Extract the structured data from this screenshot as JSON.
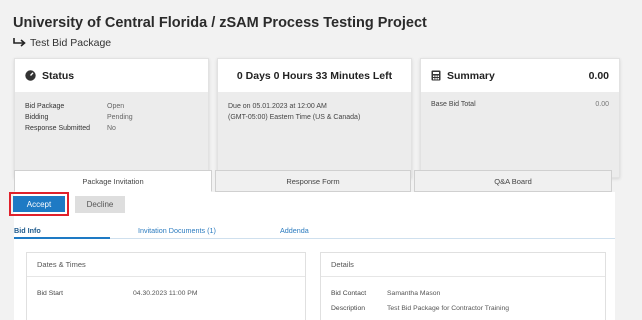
{
  "header": {
    "title": "University of Central Florida / zSAM Process Testing Project",
    "package_name": "Test Bid Package"
  },
  "status_card": {
    "title": "Status",
    "rows": [
      {
        "label": "Bid Package",
        "value": "Open"
      },
      {
        "label": "Bidding",
        "value": "Pending"
      },
      {
        "label": "Response Submitted",
        "value": "No"
      }
    ]
  },
  "time_card": {
    "title": "0 Days 0 Hours 33 Minutes Left",
    "due": "Due on 05.01.2023 at 12:00 AM",
    "timezone": "(GMT-05:00) Eastern Time (US & Canada)"
  },
  "summary_card": {
    "title": "Summary",
    "total": "0.00",
    "base_bid_label": "Base Bid Total",
    "base_bid_value": "0.00"
  },
  "tabs": [
    "Package Invitation",
    "Response Form",
    "Q&A Board"
  ],
  "actions": {
    "accept": "Accept",
    "decline": "Decline"
  },
  "subtabs": [
    "Bid Info",
    "Invitation Documents (1)",
    "Addenda"
  ],
  "dates_times": {
    "title": "Dates & Times",
    "bid_start_label": "Bid Start",
    "bid_start_value": "04.30.2023 11:00 PM"
  },
  "details": {
    "title": "Details",
    "contact_label": "Bid Contact",
    "contact_value": "Samantha Mason",
    "description_label": "Description",
    "description_value": "Test Bid Package for Contractor Training"
  }
}
